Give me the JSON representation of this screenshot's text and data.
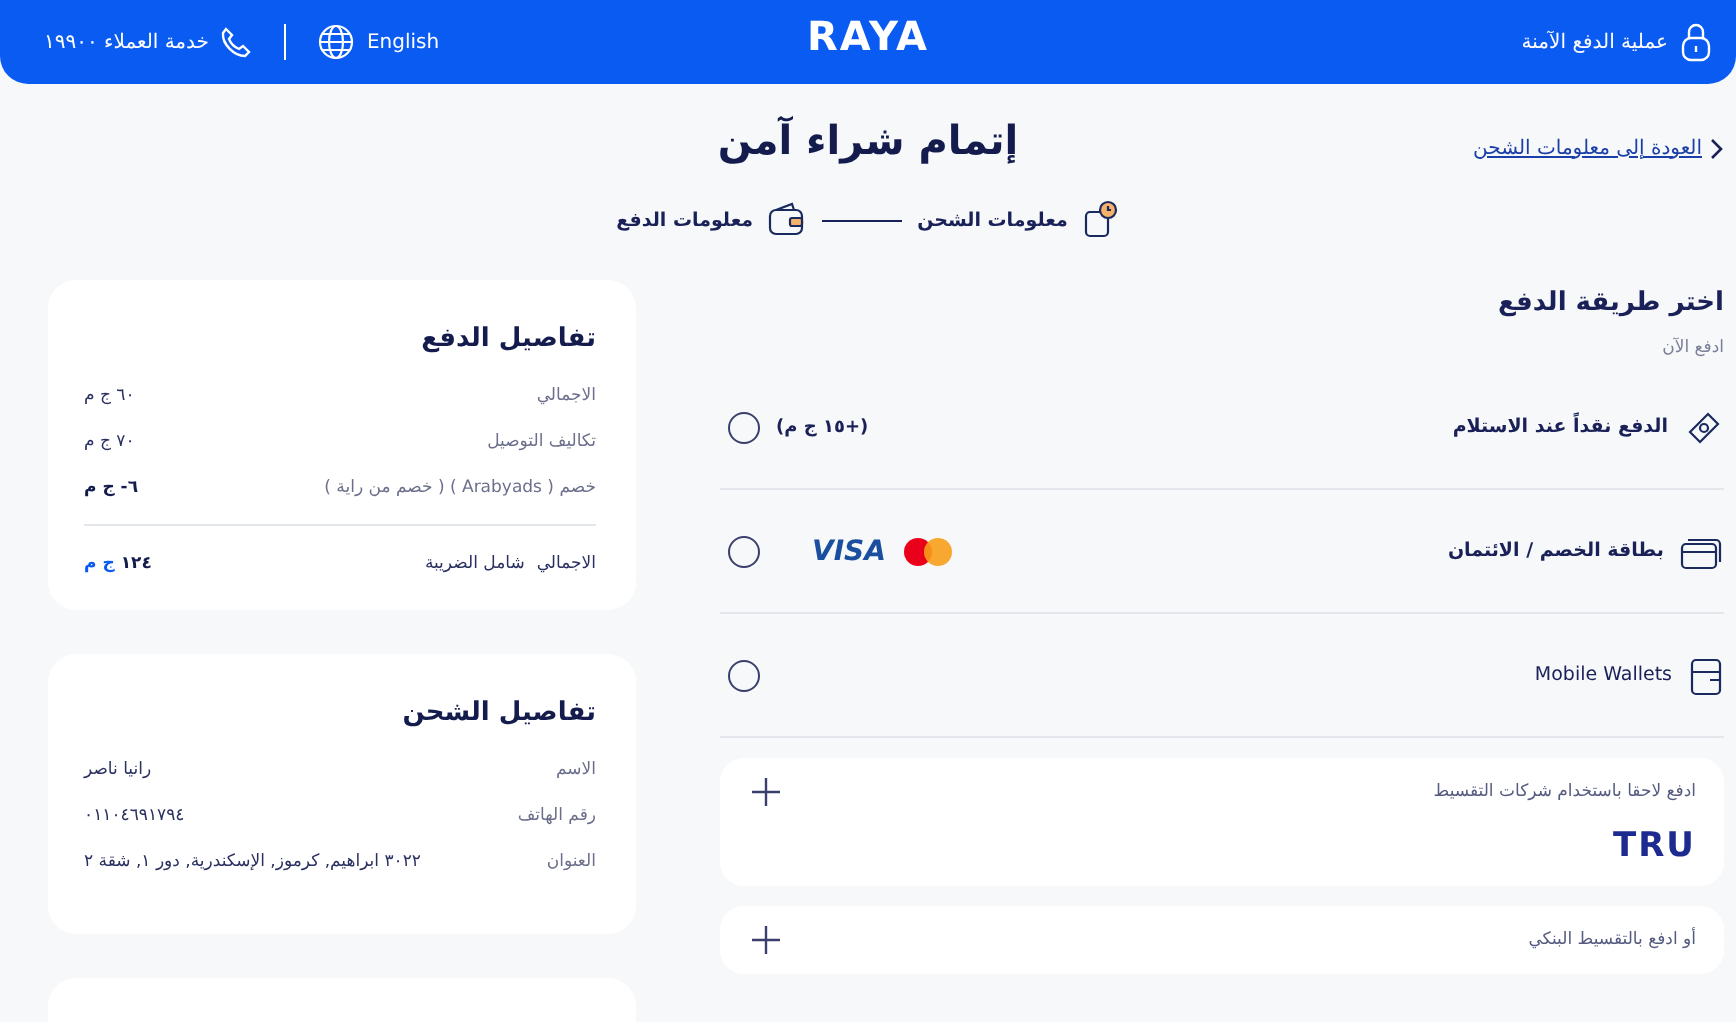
{
  "header": {
    "secure_label": "عملية الدفع الآمنة",
    "logo": "RAYA",
    "language": "English",
    "support": "خدمة العملاء ١٩٩٠٠"
  },
  "back_link": "العودة إلى معلومات الشحن",
  "title": "إتمام شراء آمن",
  "steps": [
    {
      "label": "معلومات الشحن",
      "kind": "shipping"
    },
    {
      "label": "معلومات الدفع",
      "kind": "payment"
    }
  ],
  "payment": {
    "heading": "اختر طريقة الدفع",
    "subheading": "ادفع الآن",
    "methods": [
      {
        "label": "الدفع نقداً عند الاستلام",
        "kind": "cash",
        "extra": "(+١٥ ج م)",
        "selected": false
      },
      {
        "label": "بطاقة الخصم / الائتمان",
        "kind": "card",
        "brand": "VISA",
        "selected": false
      },
      {
        "label": "Mobile Wallets",
        "kind": "wallet",
        "selected": false
      }
    ],
    "installments": [
      {
        "label": "ادفع لاحقا باستخدام شركات التقسيط",
        "logo": "TRU"
      },
      {
        "label": "أو ادفع بالتقسيط البنكي"
      }
    ]
  },
  "payment_details": {
    "title": "تفاصيل الدفع",
    "rows": [
      {
        "label": "الاجمالي",
        "value": "٦٠ ج م",
        "kind": "normal"
      },
      {
        "label": "تكاليف التوصيل",
        "value": "٧٠ ج م",
        "kind": "normal"
      },
      {
        "label": "خصم ( Arabyads ) ( خصم من راية )",
        "value": "٦- ج م",
        "kind": "discount"
      }
    ],
    "total": {
      "label": "الاجمالي",
      "note": "شامل الضريبة",
      "amount": "١٢٤",
      "currency": "ج م"
    }
  },
  "shipping_details": {
    "title": "تفاصيل الشحن",
    "rows": [
      {
        "label": "الاسم",
        "value": "رانيا ناصر"
      },
      {
        "label": "رقم الهاتف",
        "value": "٠١١٠٤٦٩١٧٩٤"
      },
      {
        "label": "العنوان",
        "value": "٣٠٢٢ ابراهيم, كرموز, الإسكندرية, دور ١, شقة ٢"
      }
    ]
  }
}
